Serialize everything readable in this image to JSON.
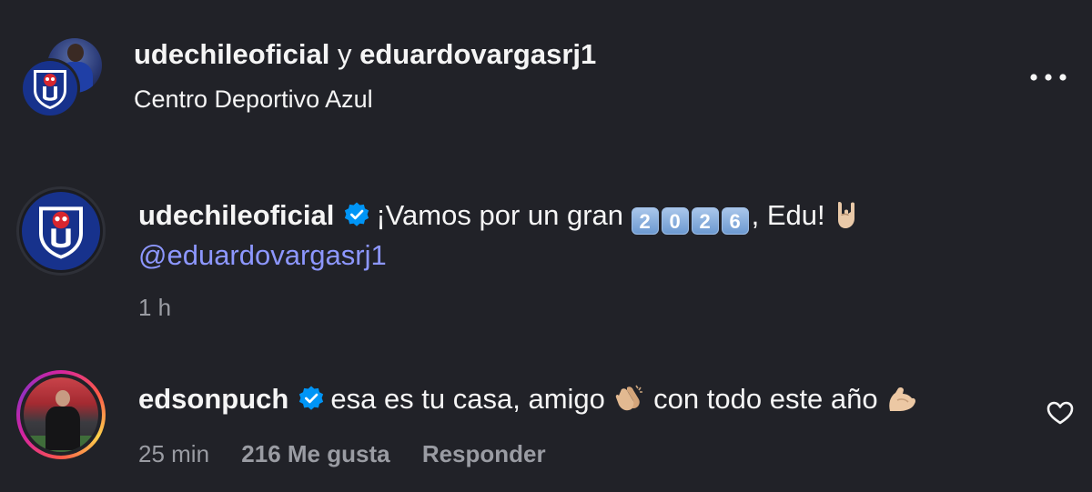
{
  "header": {
    "user1": "udechileoficial",
    "separator": "y",
    "user2": "eduardovargasrj1",
    "location": "Centro Deportivo Azul"
  },
  "comments": [
    {
      "username": "udechileoficial",
      "text_before": "¡Vamos por un gran",
      "keycaps": [
        "2",
        "0",
        "2",
        "6"
      ],
      "text_after": ", Edu!",
      "emoji": "rock-hand-emoji",
      "mention": "@eduardovargasrj1",
      "time": "1 h"
    },
    {
      "username": "edsonpuch",
      "text1": "esa es tu casa, amigo",
      "emoji1": "clapping-hands-emoji",
      "text2": "con todo este año",
      "emoji2": "flexed-biceps-emoji",
      "time": "25 min",
      "likes": "216 Me gusta",
      "reply": "Responder"
    }
  ],
  "icons": {
    "more": "more-options-icon",
    "verified": "verified-badge-icon",
    "like": "heart-icon"
  },
  "colors": {
    "background": "#212228",
    "text": "#f5f5f5",
    "muted": "#9a9ca3",
    "mention": "#8d97ff",
    "verified": "#0095f6"
  }
}
